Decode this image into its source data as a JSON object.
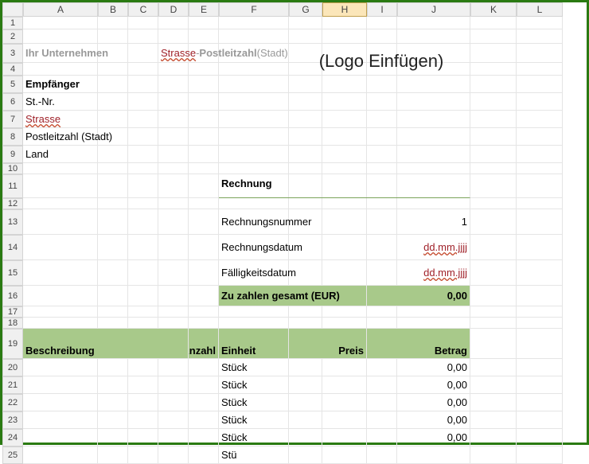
{
  "columns": [
    "A",
    "B",
    "C",
    "D",
    "E",
    "F",
    "G",
    "H",
    "I",
    "J",
    "K",
    "L"
  ],
  "selected_column": "H",
  "rows": [
    1,
    2,
    3,
    4,
    5,
    6,
    7,
    8,
    9,
    10,
    11,
    12,
    13,
    14,
    15,
    16,
    17,
    18,
    19,
    20,
    21,
    22,
    23,
    24,
    25
  ],
  "company_line": {
    "your_company": "Ihr Unternehmen",
    "street": "Strasse",
    "sep": " - ",
    "postal": "Postleitzahl",
    "city": " (Stadt)"
  },
  "logo_text": "(Logo Einfügen)",
  "recipient": {
    "heading": "Empfänger",
    "taxno": "St.-Nr.",
    "street": "Strasse",
    "postal_city": "Postleitzahl (Stadt)",
    "country": "Land"
  },
  "invoice": {
    "heading": "Rechnung",
    "number_label": "Rechnungsnummer",
    "number_value": "1",
    "date_label": "Rechnungsdatum",
    "date_value": "dd.mm.jjjj",
    "due_label": "Fälligkeitsdatum",
    "due_value": "dd.mm.jjjj",
    "total_label": "Zu zahlen gesamt (EUR)",
    "total_value": "0,00"
  },
  "table": {
    "headers": {
      "description": "Beschreibung",
      "qty": "Anzahl",
      "unit": "Einheit",
      "price": "Preis",
      "amount": "Betrag"
    },
    "rows": [
      {
        "unit": "Stück",
        "amount": "0,00"
      },
      {
        "unit": "Stück",
        "amount": "0,00"
      },
      {
        "unit": "Stück",
        "amount": "0,00"
      },
      {
        "unit": "Stück",
        "amount": "0,00"
      },
      {
        "unit": "Stück",
        "amount": "0,00"
      },
      {
        "unit": "Stü",
        "amount": ""
      }
    ]
  }
}
